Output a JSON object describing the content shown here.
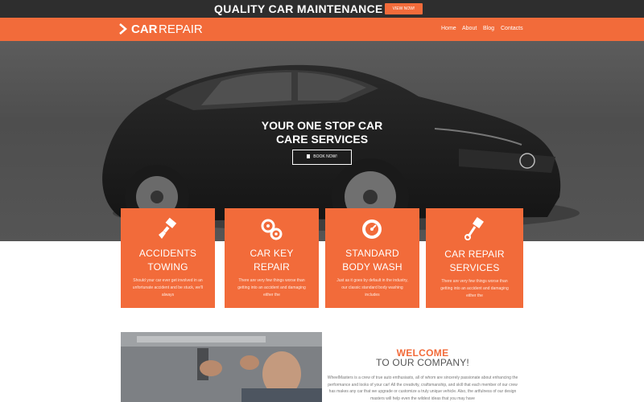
{
  "promo": {
    "title": "QUALITY CAR MAINTENANCE",
    "button": "VIEW NOW!"
  },
  "brand": {
    "bold": "CAR",
    "thin": "REPAIR"
  },
  "nav": {
    "home": "Home",
    "about": "About",
    "blog": "Blog",
    "contacts": "Contacts"
  },
  "hero": {
    "title_line1": "YOUR ONE STOP CAR",
    "title_line2": "CARE SERVICES",
    "button": "BOOK NOW!"
  },
  "services": [
    {
      "icon": "paint-brush-icon",
      "title_line1": "ACCIDENTS",
      "title_line2": "TOWING",
      "text": "Should your car ever get involved in an unfortunate accident and be stuck, we'll always"
    },
    {
      "icon": "gears-icon",
      "title_line1": "CAR KEY",
      "title_line2": "REPAIR",
      "text": "There are very few things worse than getting into an accident and damaging either the"
    },
    {
      "icon": "speedometer-icon",
      "title_line1": "STANDARD",
      "title_line2": "BODY WASH",
      "text": "Just as it goes by default in the industry, our classic standard body washing includes"
    },
    {
      "icon": "piston-icon",
      "title_line1": "CAR REPAIR",
      "title_line2": "SERVICES",
      "text": "There are very few things worse than getting into an accident and damaging either the"
    }
  ],
  "about": {
    "welcome": "WELCOME",
    "subtitle": "TO OUR COMPANY!",
    "text": "WheelMasters is a crew of true auto enthusiasts, all of whom are sincerely passionate about enhancing the performance and looks of your car! All the creativity, craftsmanship, and skill that each member of our crew has makes any car that we upgrade or customize a truly unique vehicle. Also, the artfulness of our design masters will help even the wildest ideas that you may have"
  },
  "colors": {
    "accent": "#f26b3a",
    "dark_bar": "#2e2e2e",
    "hero_bg": "#555555"
  }
}
